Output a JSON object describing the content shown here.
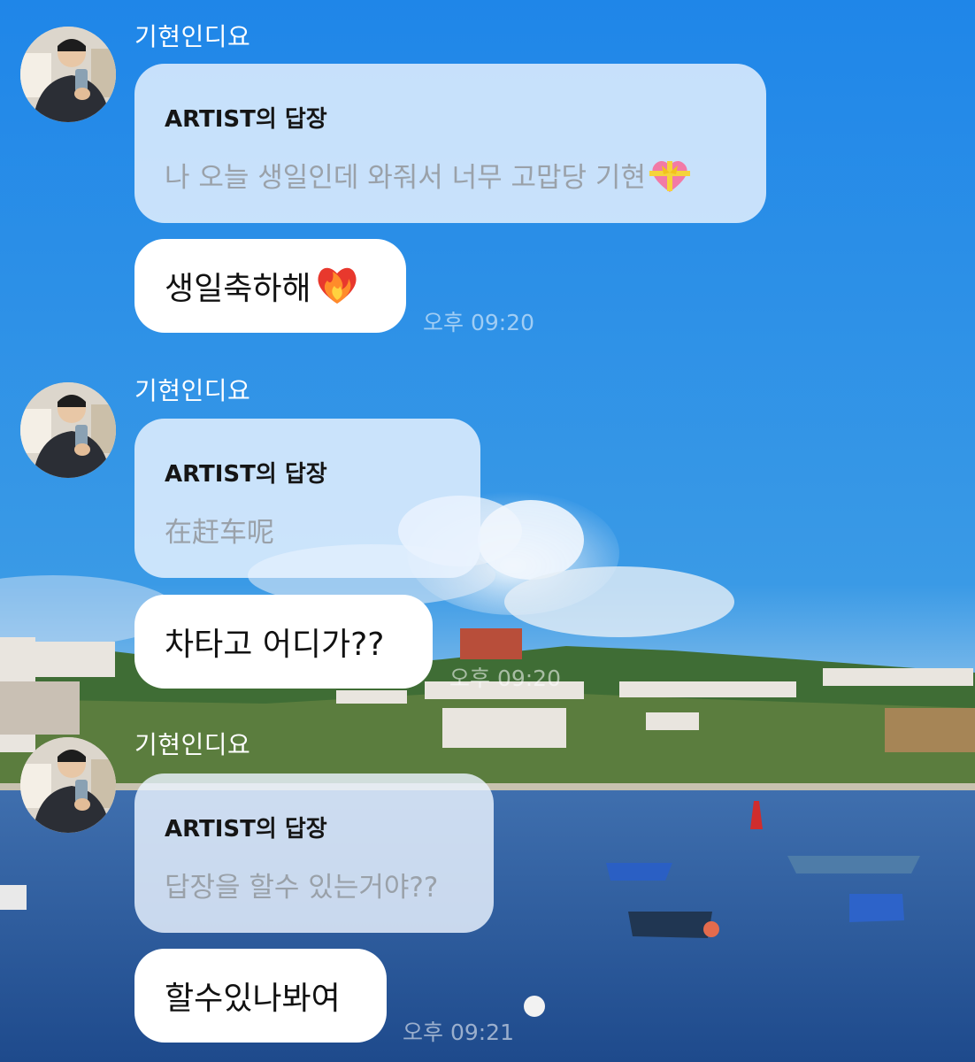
{
  "messages": [
    {
      "sender": "기현인디요",
      "reply_title": "ARTIST의 답장",
      "reply_text": "나 오늘 생일인데 와줘서 너무 고맙당 기현",
      "reply_emoji": "heart-with-ribbon-icon",
      "message": "생일축하해",
      "message_emoji": "heart-on-fire-icon",
      "time": "오후 09:20"
    },
    {
      "sender": "기현인디요",
      "reply_title": "ARTIST의 답장",
      "reply_text": "在赶车呢",
      "message": "차타고 어디가??",
      "time": "오후 09:20"
    },
    {
      "sender": "기현인디요",
      "reply_title": "ARTIST의 답장",
      "reply_text": "답장을 할수 있는거야??",
      "message": "할수있나봐여",
      "time": "오후 09:21"
    }
  ],
  "colors": {
    "sky": "#2f8fe6",
    "sea": "#24508f",
    "bubble": "#ffffff",
    "reply_bubble": "#eaf2fd"
  }
}
